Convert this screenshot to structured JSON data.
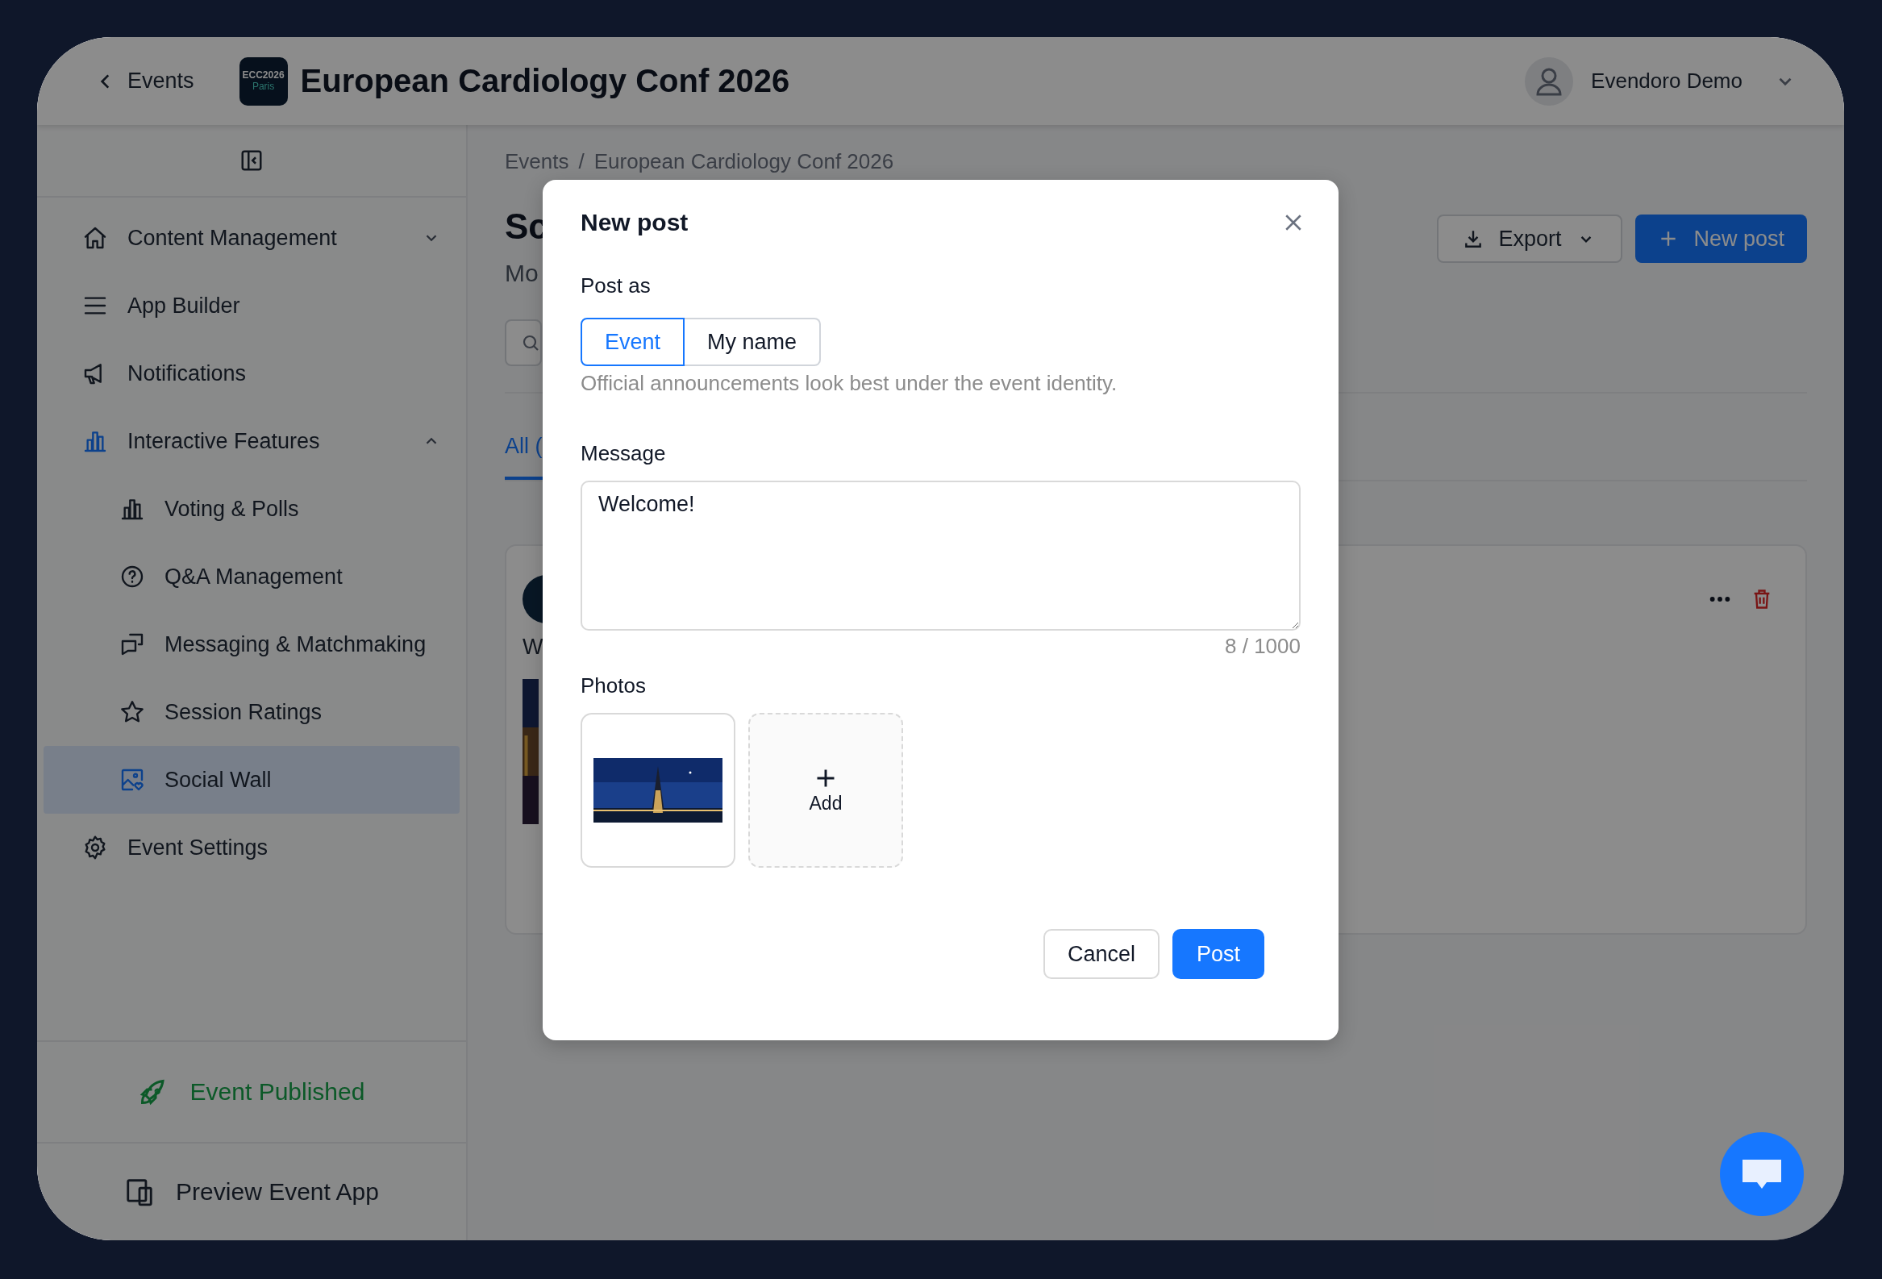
{
  "top_bar": {
    "back_link": "Events",
    "logo": {
      "line_1": "ECC2026",
      "line_2": "Paris"
    },
    "title": "European Cardiology Conf 2026",
    "user_name": "Evendoro Demo"
  },
  "sidebar": {
    "items": [
      {
        "label": "Content Management",
        "selected": false,
        "expanded": false
      },
      {
        "label": "App Builder",
        "selected": false
      },
      {
        "label": "Notifications",
        "selected": false
      },
      {
        "label": "Interactive Features",
        "selected": false,
        "expanded": true,
        "children": [
          {
            "label": "Voting & Polls",
            "selected": false
          },
          {
            "label": "Q&A Management",
            "selected": false
          },
          {
            "label": "Messaging & Matchmaking",
            "selected": false
          },
          {
            "label": "Session Ratings",
            "selected": false
          },
          {
            "label": "Social Wall",
            "selected": true
          }
        ]
      },
      {
        "label": "Event Settings",
        "selected": false
      }
    ],
    "status": "Event Published",
    "preview": "Preview Event App"
  },
  "main": {
    "breadcrumb": [
      "Events",
      "/",
      "European Cardiology Conf 2026"
    ],
    "title": "Sc",
    "subtitle": "Mo",
    "export_button": "Export",
    "new_button": "New post",
    "tabs": [
      {
        "label": "All (",
        "selected": true
      }
    ],
    "post": {
      "text": "W"
    }
  },
  "modal": {
    "title": "New post",
    "post_as": {
      "label": "Post as",
      "options": [
        {
          "label": "Event",
          "selected": true
        },
        {
          "label": "My name",
          "selected": false
        }
      ],
      "hint": "Official announcements look best under the event identity."
    },
    "message": {
      "label": "Message",
      "value": "Welcome!",
      "counter": "8 / 1000"
    },
    "photos": {
      "label": "Photos",
      "add_label": "Add"
    },
    "cancel_button": "Cancel",
    "submit_button": "Post"
  }
}
